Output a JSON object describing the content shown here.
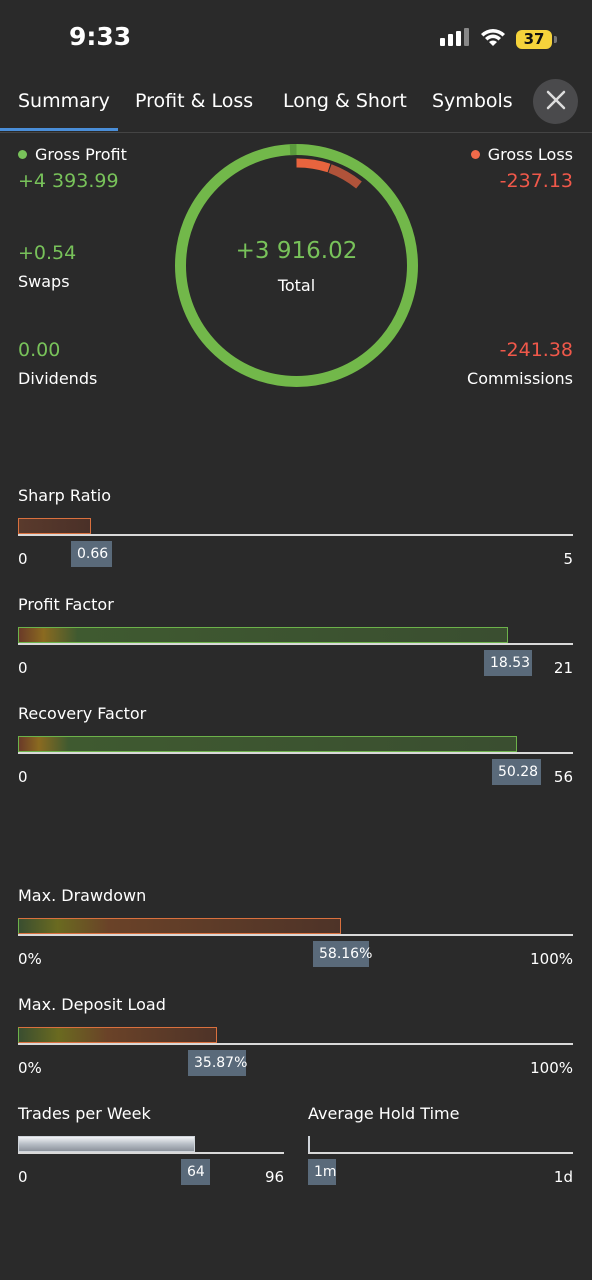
{
  "status_bar": {
    "time": "9:33",
    "battery": "37"
  },
  "tabs": [
    {
      "label": "Summary"
    },
    {
      "label": "Profit & Loss"
    },
    {
      "label": "Long & Short"
    },
    {
      "label": "Symbols"
    }
  ],
  "summary": {
    "gross_profit_label": "Gross Profit",
    "gross_profit_value": "+4 393.99",
    "gross_loss_label": "Gross Loss",
    "gross_loss_value": "-237.13",
    "swaps_value": "+0.54",
    "swaps_label": "Swaps",
    "dividends_value": "0.00",
    "dividends_label": "Dividends",
    "commissions_value": "-241.38",
    "commissions_label": "Commissions",
    "total_value": "+3 916.02",
    "total_label": "Total",
    "colors": {
      "profit": "#78c25a",
      "loss": "#f0584a"
    }
  },
  "metrics": {
    "sharp_ratio": {
      "title": "Sharp Ratio",
      "min": "0",
      "max": "5",
      "value": "0.66",
      "fraction": 0.132
    },
    "profit_factor": {
      "title": "Profit Factor",
      "min": "0",
      "max": "21",
      "value": "18.53",
      "fraction": 0.882
    },
    "recovery_factor": {
      "title": "Recovery Factor",
      "min": "0",
      "max": "56",
      "value": "50.28",
      "fraction": 0.898
    },
    "max_drawdown": {
      "title": "Max. Drawdown",
      "min": "0%",
      "max": "100%",
      "value": "58.16%",
      "fraction": 0.5816
    },
    "max_deposit_load": {
      "title": "Max. Deposit Load",
      "min": "0%",
      "max": "100%",
      "value": "35.87%",
      "fraction": 0.3587
    },
    "trades_per_week": {
      "title": "Trades per Week",
      "min": "0",
      "max": "96",
      "value": "64",
      "fraction": 0.667
    },
    "average_hold_time": {
      "title": "Average Hold Time",
      "min": "1m",
      "max": "1d",
      "value": "1m",
      "fraction": 0.0
    }
  }
}
